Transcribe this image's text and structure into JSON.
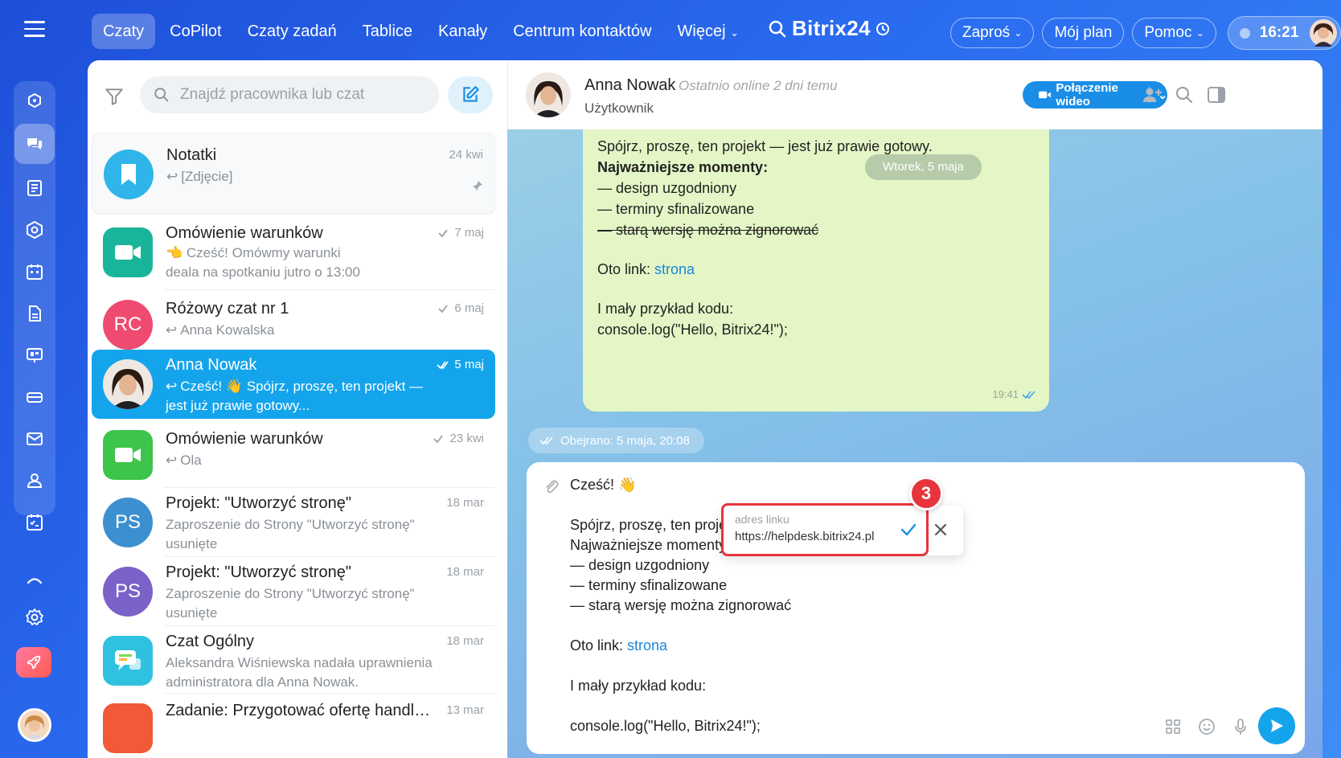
{
  "topnav": {
    "tabs": [
      "Czaty",
      "CoPilot",
      "Czaty zadań",
      "Tablice",
      "Kanały",
      "Centrum kontaktów",
      "Więcej"
    ],
    "brand": "Bitrix24",
    "invite": "Zaproś",
    "plan": "Mój plan",
    "help": "Pomoc",
    "time": "16:21"
  },
  "search": {
    "placeholder": "Znajdź pracownika lub czat"
  },
  "chats": [
    {
      "title": "Notatki",
      "date": "24 kwi",
      "sub1": "[Zdjęcie]",
      "avatar": "bookmark",
      "color": "#2fb5ea"
    },
    {
      "title": "Omówienie warunków",
      "date": "7 maj",
      "sub1": "👈 Cześć! Omówmy warunki",
      "sub2": "deala na spotkaniu jutro o 13:00",
      "color": "#19b59a"
    },
    {
      "title": "Różowy czat nr 1",
      "date": "6 maj",
      "sub1": "Anna Kowalska",
      "initials": "RC",
      "color": "#ef4a6f"
    },
    {
      "title": "Anna Nowak",
      "date": "5 maj",
      "sub1": "Cześć! 👋 Spójrz, proszę, ten projekt —",
      "sub2": "jest już prawie gotowy..."
    },
    {
      "title": "Omówienie warunków",
      "date": "23 kwi",
      "sub1": "Ola",
      "color": "#3dc44b"
    },
    {
      "title": "Projekt: \"Utworzyć stronę\"",
      "date": "18 mar",
      "sub1": "Zaproszenie do Strony \"Utworzyć stronę\"",
      "sub2": "usunięte",
      "initials": "PS",
      "color": "#3c90d0"
    },
    {
      "title": "Projekt: \"Utworzyć stronę\"",
      "date": "18 mar",
      "sub1": "Zaproszenie do Strony \"Utworzyć stronę\"",
      "sub2": "usunięte",
      "initials": "PS",
      "color": "#7a62c9"
    },
    {
      "title": "Czat Ogólny",
      "date": "18 mar",
      "sub1": "Aleksandra Wiśniewska nadała uprawnienia",
      "sub2": "administratora dla Anna Nowak.",
      "color": "#2fc2e0"
    },
    {
      "title": "Zadanie: Przygotować ofertę handlową",
      "date": "13 mar",
      "color": "#f05a36"
    }
  ],
  "chat": {
    "name": "Anna Nowak",
    "status": "Ostatnio online 2 dni temu",
    "role": "Użytkownik",
    "video_label": "Połączenie wideo",
    "day_badge": "Wtorek, 5 maja",
    "viewed": "Obejrano: 5 maja, 20:08",
    "message": {
      "l1": "Spójrz, proszę, ten projekt — jest już prawie gotowy.",
      "l2": "Najważniejsze momenty:",
      "l3": "— design uzgodniony",
      "l4": "— terminy sfinalizowane",
      "l5": "— starą wersję można zignorować",
      "link_prefix": "Oto link: ",
      "link_text": "strona",
      "l7": "I mały przykład kodu:",
      "l8": "console.log(\"Hello, Bitrix24!\");",
      "time": "19:41"
    },
    "draft": {
      "l0": "Cześć! 👋",
      "l1": "Spójrz, proszę, ten projekt — jest już prawie gotowy.",
      "l2": "Najważniejsze momenty:",
      "l3": "— design uzgodniony",
      "l4": "— terminy sfinalizowane",
      "l5": "— starą wersję można zignorować",
      "link_prefix": "Oto link: ",
      "link_text": "strona",
      "l7": "I mały przykład kodu:",
      "l8": "console.log(\"Hello, Bitrix24!\");"
    }
  },
  "link_popup": {
    "label": "adres linku",
    "url": "https://helpdesk.bitrix24.pl",
    "step": "3"
  },
  "colors": {
    "accent": "#14a4ec",
    "bubble": "#e4f6c6",
    "highlight": "#e8343c"
  }
}
